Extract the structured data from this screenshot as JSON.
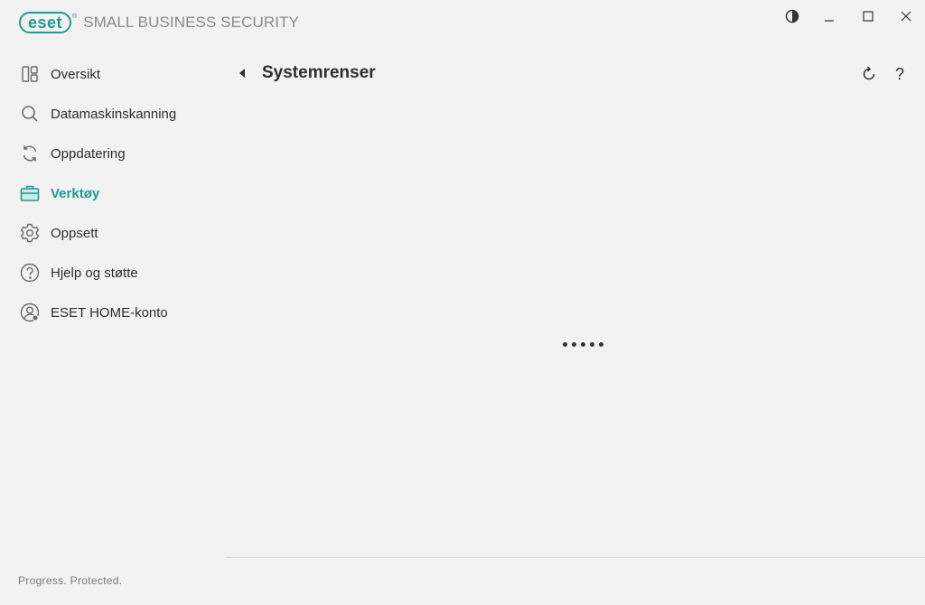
{
  "app": {
    "logo_text": "eset",
    "logo_reg": "®",
    "product_name": "SMALL BUSINESS SECURITY"
  },
  "window_controls": {
    "theme": "contrast-icon",
    "minimize": "minimize-icon",
    "maximize": "maximize-icon",
    "close": "close-icon"
  },
  "sidebar": {
    "items": [
      {
        "label": "Oversikt",
        "icon": "dashboard-icon",
        "active": false
      },
      {
        "label": "Datamaskinskanning",
        "icon": "search-icon",
        "active": false
      },
      {
        "label": "Oppdatering",
        "icon": "refresh-icon",
        "active": false
      },
      {
        "label": "Verktøy",
        "icon": "toolbox-icon",
        "active": true
      },
      {
        "label": "Oppsett",
        "icon": "gear-icon",
        "active": false
      },
      {
        "label": "Hjelp og støtte",
        "icon": "help-circle-icon",
        "active": false
      },
      {
        "label": "ESET HOME-konto",
        "icon": "account-icon",
        "active": false
      }
    ],
    "footer": "Progress. Protected."
  },
  "main": {
    "title": "Systemrenser",
    "header_actions": [
      "reload-icon",
      "help-icon"
    ],
    "help_glyph": "?"
  },
  "colors": {
    "accent": "#1f9b8f",
    "background": "#f2f2f2",
    "text": "#2e2e2e",
    "muted": "#8a8a8a"
  }
}
